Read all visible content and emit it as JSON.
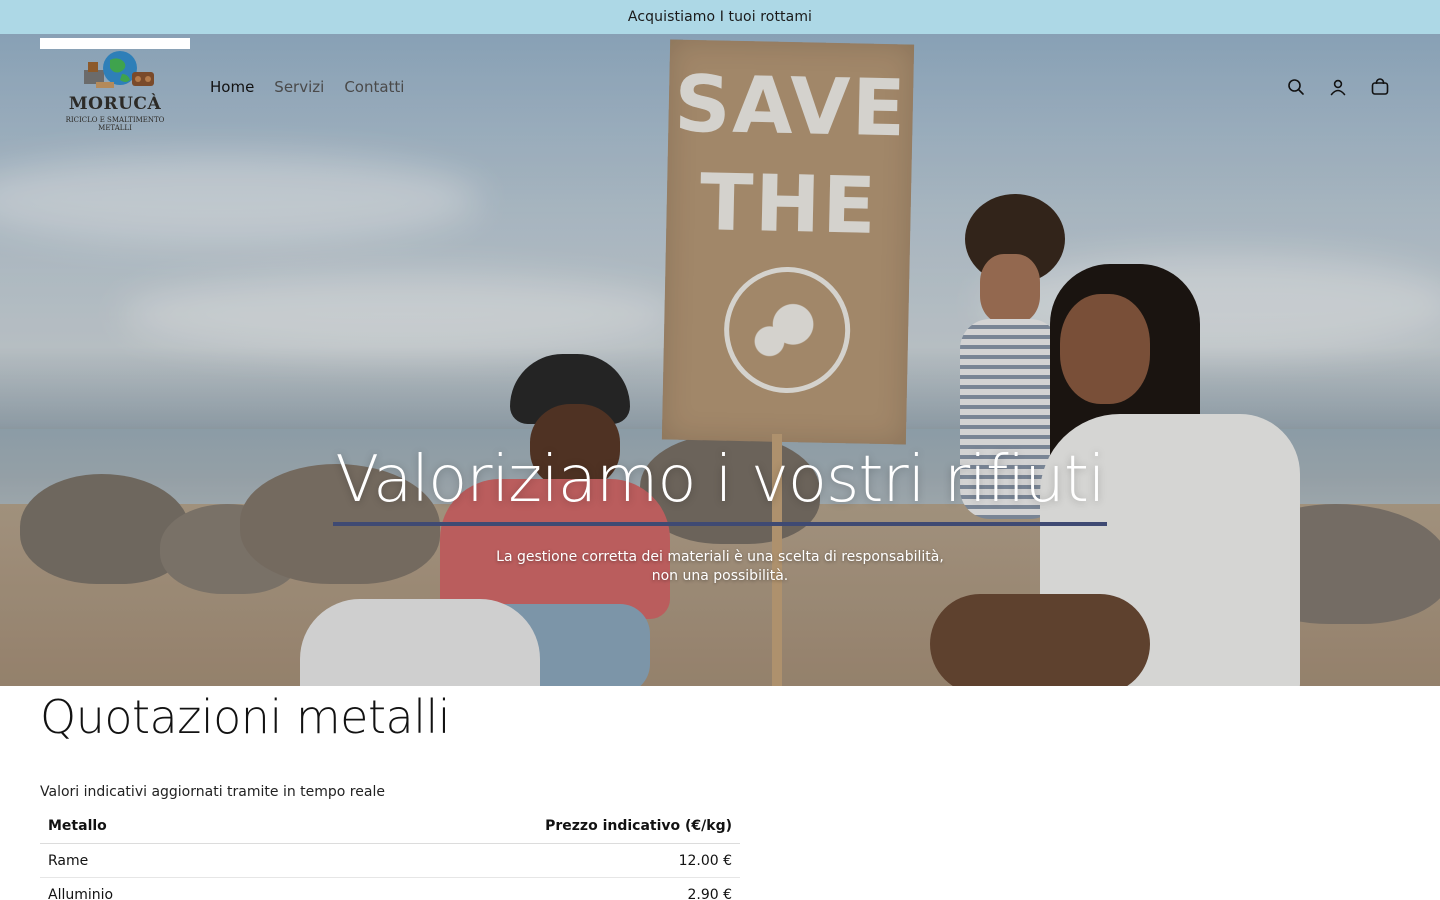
{
  "announcement": {
    "text": "Acquistiamo I tuoi rottami"
  },
  "header": {
    "logo": {
      "name": "MORUCÀ",
      "tagline_line1": "RICICLO E SMALTIMENTO",
      "tagline_line2": "METALLI"
    },
    "nav": [
      {
        "label": "Home",
        "active": true
      },
      {
        "label": "Servizi",
        "active": false
      },
      {
        "label": "Contatti",
        "active": false
      }
    ],
    "icons": [
      "search-icon",
      "account-icon",
      "cart-icon"
    ]
  },
  "hero": {
    "sign_line1": "SAVE",
    "sign_line2": "THE",
    "title": "Valoriziamo i vostri rifiuti",
    "subtitle": "La gestione corretta dei materiali è una scelta di responsabilità, non una possibilità."
  },
  "quotes": {
    "title": "Quotazioni metalli",
    "subtitle": "Valori indicativi aggiornati tramite in tempo reale",
    "columns": [
      "Metallo",
      "Prezzo indicativo (€/kg)"
    ],
    "rows": [
      {
        "metal": "Rame",
        "price": "12.00 €"
      },
      {
        "metal": "Alluminio",
        "price": "2.90 €"
      }
    ]
  },
  "colors": {
    "announcement_bg": "#add8e6",
    "title_underline": "#3f4a73",
    "text": "#121212"
  }
}
